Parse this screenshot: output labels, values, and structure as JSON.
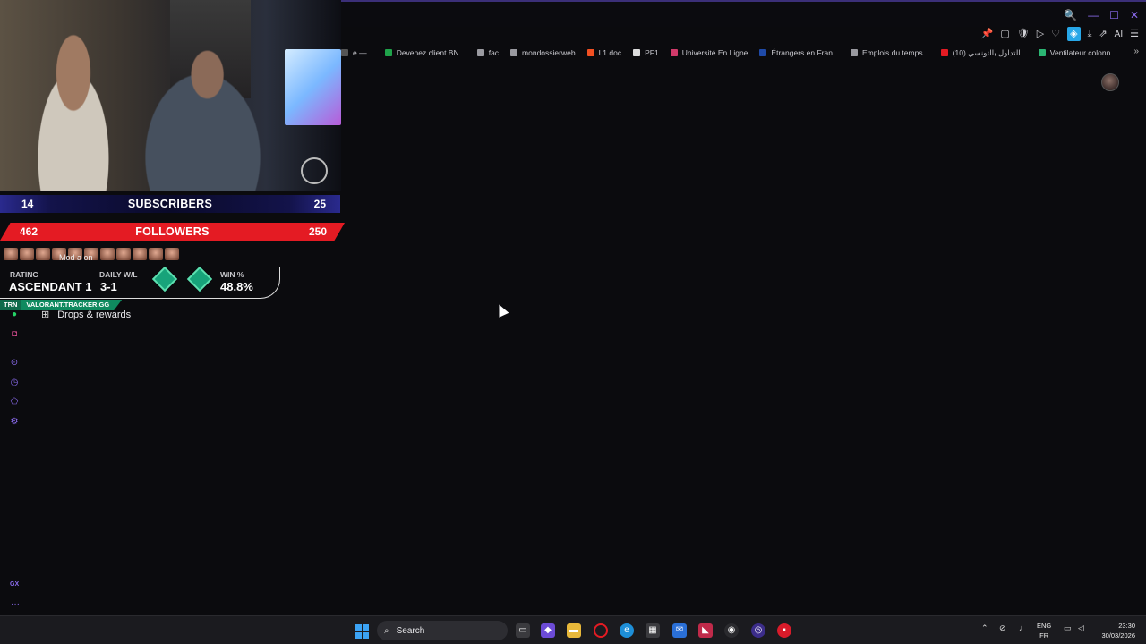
{
  "window": {
    "controls": [
      "🔍",
      "—",
      "☐",
      "✕"
    ]
  },
  "toolbar": {
    "icons": [
      "📌",
      "▢",
      "🛡",
      "▷",
      "♡",
      "◈",
      "⤓",
      "⇗"
    ],
    "ai_label": "AI",
    "menu_icon": "☰"
  },
  "bookmarks": [
    {
      "label": "e —...",
      "color": "#555555"
    },
    {
      "label": "Devenez client BN...",
      "color": "#1fa34a"
    },
    {
      "label": "fac",
      "color": "#9a9aa0"
    },
    {
      "label": "mondossierweb",
      "color": "#9a9aa0"
    },
    {
      "label": "L1 doc",
      "color": "#f25022"
    },
    {
      "label": "PF1",
      "color": "#dddddd"
    },
    {
      "label": "Université En Ligne",
      "color": "#d13a6a"
    },
    {
      "label": "Étrangers en Fran...",
      "color": "#1f4aa8"
    },
    {
      "label": "Emplois du temps...",
      "color": "#9a9aa0"
    },
    {
      "label": "التداول بالتونسي (10)...",
      "color": "#e41b23"
    },
    {
      "label": "Ventilateur colonn...",
      "color": "#2bb673"
    }
  ],
  "bookmarks_more": "»",
  "sidebar": {
    "drops_label": "Drops & rewards"
  },
  "overlay": {
    "subscribers": {
      "current": "14",
      "label": "SUBSCRIBERS",
      "goal": "25"
    },
    "followers": {
      "current": "462",
      "label": "FOLLOWERS",
      "goal": "250"
    },
    "mod_text": "Mod a on",
    "tracker": {
      "rating_label": "RATING",
      "rating_value": "ASCENDANT 1",
      "daily_label": "DAILY W/L",
      "daily_value": "3-1",
      "win_label": "WIN %",
      "win_value": "48.8%",
      "brand": "TRN",
      "site": "VALORANT.TRACKER.GG"
    }
  },
  "taskbar": {
    "search_label": "Search",
    "language_top": "ENG",
    "language_bottom": "FR",
    "time": "23:30",
    "date": "30/03/2026"
  }
}
